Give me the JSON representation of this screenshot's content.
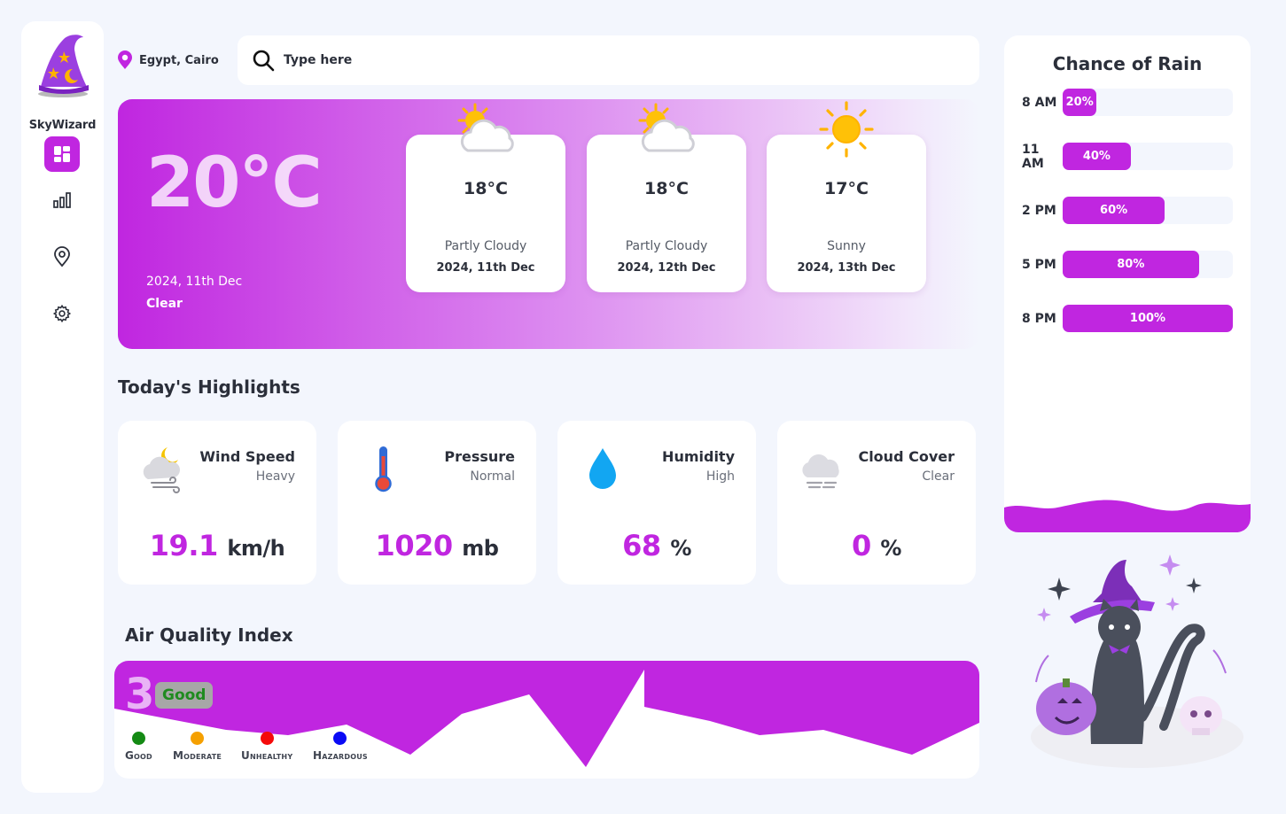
{
  "app": {
    "name": "SkyWizard"
  },
  "nav": {
    "items": [
      {
        "id": "dashboard",
        "icon": "dashboard-icon",
        "active": true
      },
      {
        "id": "stats",
        "icon": "bar-chart-icon",
        "active": false
      },
      {
        "id": "location",
        "icon": "map-pin-icon",
        "active": false
      },
      {
        "id": "settings",
        "icon": "gear-icon",
        "active": false
      }
    ]
  },
  "header": {
    "location": "Egypt, Cairo",
    "search_placeholder": "Type here"
  },
  "current": {
    "temp": "20°C",
    "date": "2024, 11th Dec",
    "condition": "Clear"
  },
  "forecast": [
    {
      "temp": "18°C",
      "condition": "Partly Cloudy",
      "date": "2024, 11th Dec",
      "icon": "partly-cloudy-icon"
    },
    {
      "temp": "18°C",
      "condition": "Partly Cloudy",
      "date": "2024, 12th Dec",
      "icon": "partly-cloudy-icon"
    },
    {
      "temp": "17°C",
      "condition": "Sunny",
      "date": "2024, 13th Dec",
      "icon": "sun-icon"
    }
  ],
  "highlights": {
    "title": "Today's Highlights",
    "cards": [
      {
        "title": "Wind Speed",
        "sub": "Heavy",
        "value": "19.1",
        "unit": "km/h",
        "icon": "wind-moon-icon"
      },
      {
        "title": "Pressure",
        "sub": "Normal",
        "value": "1020",
        "unit": "mb",
        "icon": "thermometer-icon"
      },
      {
        "title": "Humidity",
        "sub": "High",
        "value": "68",
        "unit": "%",
        "icon": "droplet-icon"
      },
      {
        "title": "Cloud Cover",
        "sub": "Clear",
        "value": "0",
        "unit": "%",
        "icon": "fog-cloud-icon"
      }
    ]
  },
  "aqi": {
    "title": "Air Quality Index",
    "value": "3",
    "status": "Good",
    "legend": [
      {
        "label": "Good",
        "color": "#148a14"
      },
      {
        "label": "Moderate",
        "color": "#f5a000"
      },
      {
        "label": "Unhealthy",
        "color": "#f50a0a"
      },
      {
        "label": "Hazardous",
        "color": "#0a0af5"
      }
    ]
  },
  "rain": {
    "title": "Chance of Rain",
    "rows": [
      {
        "time": "8 AM",
        "label": "20%",
        "value": 0.2
      },
      {
        "time": "11 AM",
        "label": "40%",
        "value": 0.4
      },
      {
        "time": "2 PM",
        "label": "60%",
        "value": 0.6
      },
      {
        "time": "5 PM",
        "label": "80%",
        "value": 0.8
      },
      {
        "time": "8 PM",
        "label": "100%",
        "value": 1.0
      }
    ]
  },
  "colors": {
    "accent": "#c026e0",
    "background": "#f3f6fd"
  }
}
